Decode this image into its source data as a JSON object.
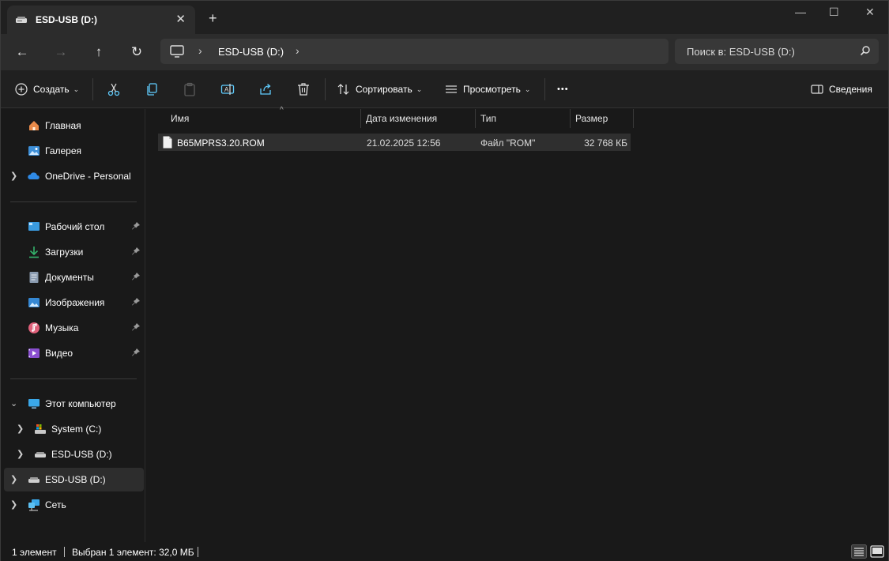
{
  "window": {
    "tab_title": "ESD-USB (D:)",
    "tab_close": "✕",
    "new_tab": "+",
    "minimize": "—",
    "maximize": "☐",
    "close": "✕"
  },
  "nav": {
    "back": "←",
    "forward": "→",
    "up": "↑",
    "refresh": "↻",
    "breadcrumb": [
      "ESD-USB (D:)"
    ],
    "chevron": "›",
    "search_placeholder": "Поиск в: ESD-USB (D:)"
  },
  "toolbar": {
    "create": "Создать",
    "sort": "Сортировать",
    "view": "Просмотреть",
    "more": "•••",
    "details": "Сведения"
  },
  "sidebar": {
    "quick": [
      {
        "label": "Главная",
        "icon": "home-icon"
      },
      {
        "label": "Галерея",
        "icon": "gallery-icon"
      },
      {
        "label": "OneDrive - Personal",
        "icon": "onedrive-icon"
      }
    ],
    "pinned": [
      {
        "label": "Рабочий стол",
        "icon": "desktop-icon"
      },
      {
        "label": "Загрузки",
        "icon": "downloads-icon"
      },
      {
        "label": "Документы",
        "icon": "documents-icon"
      },
      {
        "label": "Изображения",
        "icon": "pictures-icon"
      },
      {
        "label": "Музыка",
        "icon": "music-icon"
      },
      {
        "label": "Видео",
        "icon": "videos-icon"
      }
    ],
    "this_pc": "Этот компьютер",
    "drives": [
      {
        "label": "System (C:)",
        "icon": "system-drive-icon"
      },
      {
        "label": "ESD-USB (D:)",
        "icon": "usb-drive-icon"
      }
    ],
    "usb_root": "ESD-USB (D:)",
    "network": "Сеть"
  },
  "columns": {
    "name": "Имя",
    "date": "Дата изменения",
    "type": "Тип",
    "size": "Размер"
  },
  "files": [
    {
      "name": "B65MPRS3.20.ROM",
      "date": "21.02.2025 12:56",
      "type": "Файл \"ROM\"",
      "size": "32 768 КБ",
      "selected": true
    }
  ],
  "status": {
    "count": "1 элемент",
    "selection": "Выбран 1 элемент: 32,0 МБ"
  },
  "colors": {
    "accent": "#4cc2ff",
    "background": "#191919",
    "toolbar": "#202020",
    "selection": "#2f2f2f"
  }
}
